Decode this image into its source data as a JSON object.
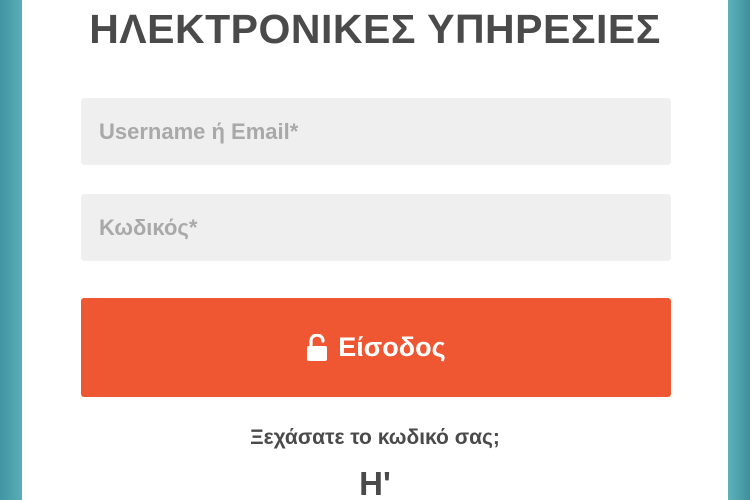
{
  "page": {
    "title": "ΗΛΕΚΤΡΟΝΙΚΕΣ ΥΠΗΡΕΣΙΕΣ"
  },
  "form": {
    "username_placeholder": "Username ή Email*",
    "password_placeholder": "Κωδικός*",
    "username_value": "",
    "password_value": ""
  },
  "login_button": {
    "label": "Είσοδος",
    "icon": "unlock-icon"
  },
  "forgot_password": "Ξεχάσατε το κωδικό σας;",
  "or_separator": "Η'",
  "colors": {
    "accent": "#ef5733",
    "background": "#4fa3ad",
    "field_background": "#efefef",
    "text": "#4a4a4a"
  }
}
